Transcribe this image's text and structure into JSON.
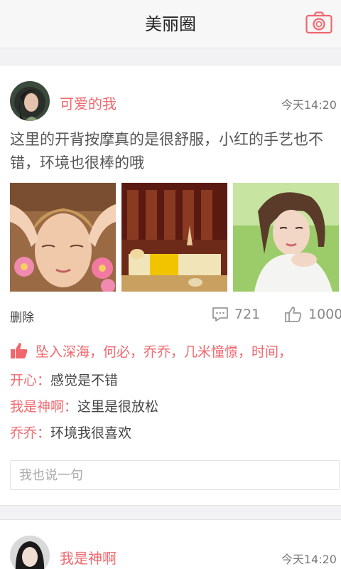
{
  "header": {
    "title": "美丽圈",
    "camera_icon": "camera-icon",
    "accent": "#f0686e"
  },
  "posts": [
    {
      "username": "可爱的我",
      "time": "今天14:20",
      "content": "这里的开背按摩真的是很舒服，小红的手艺也不错，环境也很棒的哦",
      "photos": [
        "spa-face-massage-photo",
        "spa-room-photo",
        "woman-portrait-photo"
      ],
      "delete_label": "删除",
      "comment_count": "721",
      "like_count": "1000",
      "likers": "坠入深海，何必，乔乔，几米憧憬，时间，",
      "comments": [
        {
          "author": "开心",
          "sep": "：",
          "text": "感觉是不错"
        },
        {
          "author": "我是神啊",
          "sep": "：",
          "text": "这里是很放松"
        },
        {
          "author": "乔乔",
          "sep": "：",
          "text": "环境我很喜欢"
        }
      ],
      "reply_placeholder": "我也说一句"
    },
    {
      "username": "我是神啊",
      "time": "今天14:20"
    }
  ]
}
